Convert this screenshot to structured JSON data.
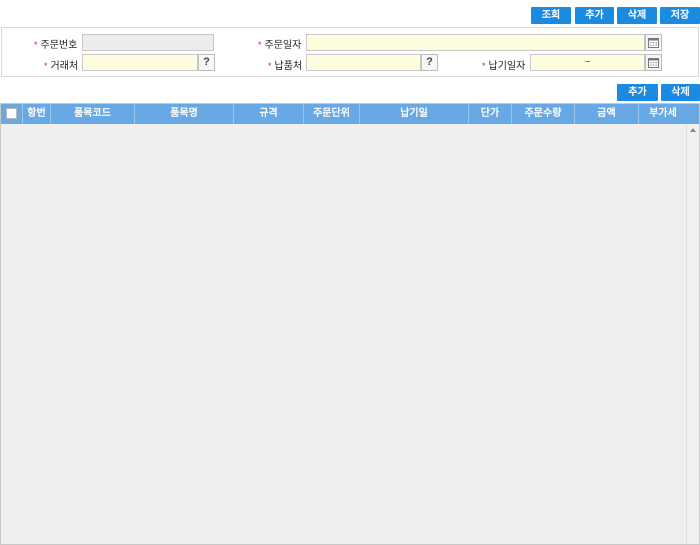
{
  "toolbar": {
    "search_label": "조회",
    "add_label": "추가",
    "delete_label": "삭제",
    "save_label": "저장"
  },
  "form": {
    "order_no_label": "주문번호",
    "order_no_value": "",
    "order_date_label": "주문일자",
    "order_date_value": "",
    "client_label": "거래처",
    "client_value": "",
    "delivery_place_label": "납품처",
    "delivery_place_value": "",
    "delivery_date_label": "납기일자",
    "delivery_date_value": "~",
    "required_mark": "*",
    "lookup_glyph": "?"
  },
  "grid_toolbar": {
    "add_label": "추가",
    "delete_label": "삭제"
  },
  "grid": {
    "columns": [
      "항번",
      "품목코드",
      "품목명",
      "규격",
      "주문단위",
      "납기일",
      "단가",
      "주문수량",
      "금액",
      "부가세"
    ],
    "rows": []
  },
  "colors": {
    "button": "#1a8be0",
    "header": "#68a8e4",
    "required": "#e2231a",
    "input_bg": "#fffde0"
  }
}
